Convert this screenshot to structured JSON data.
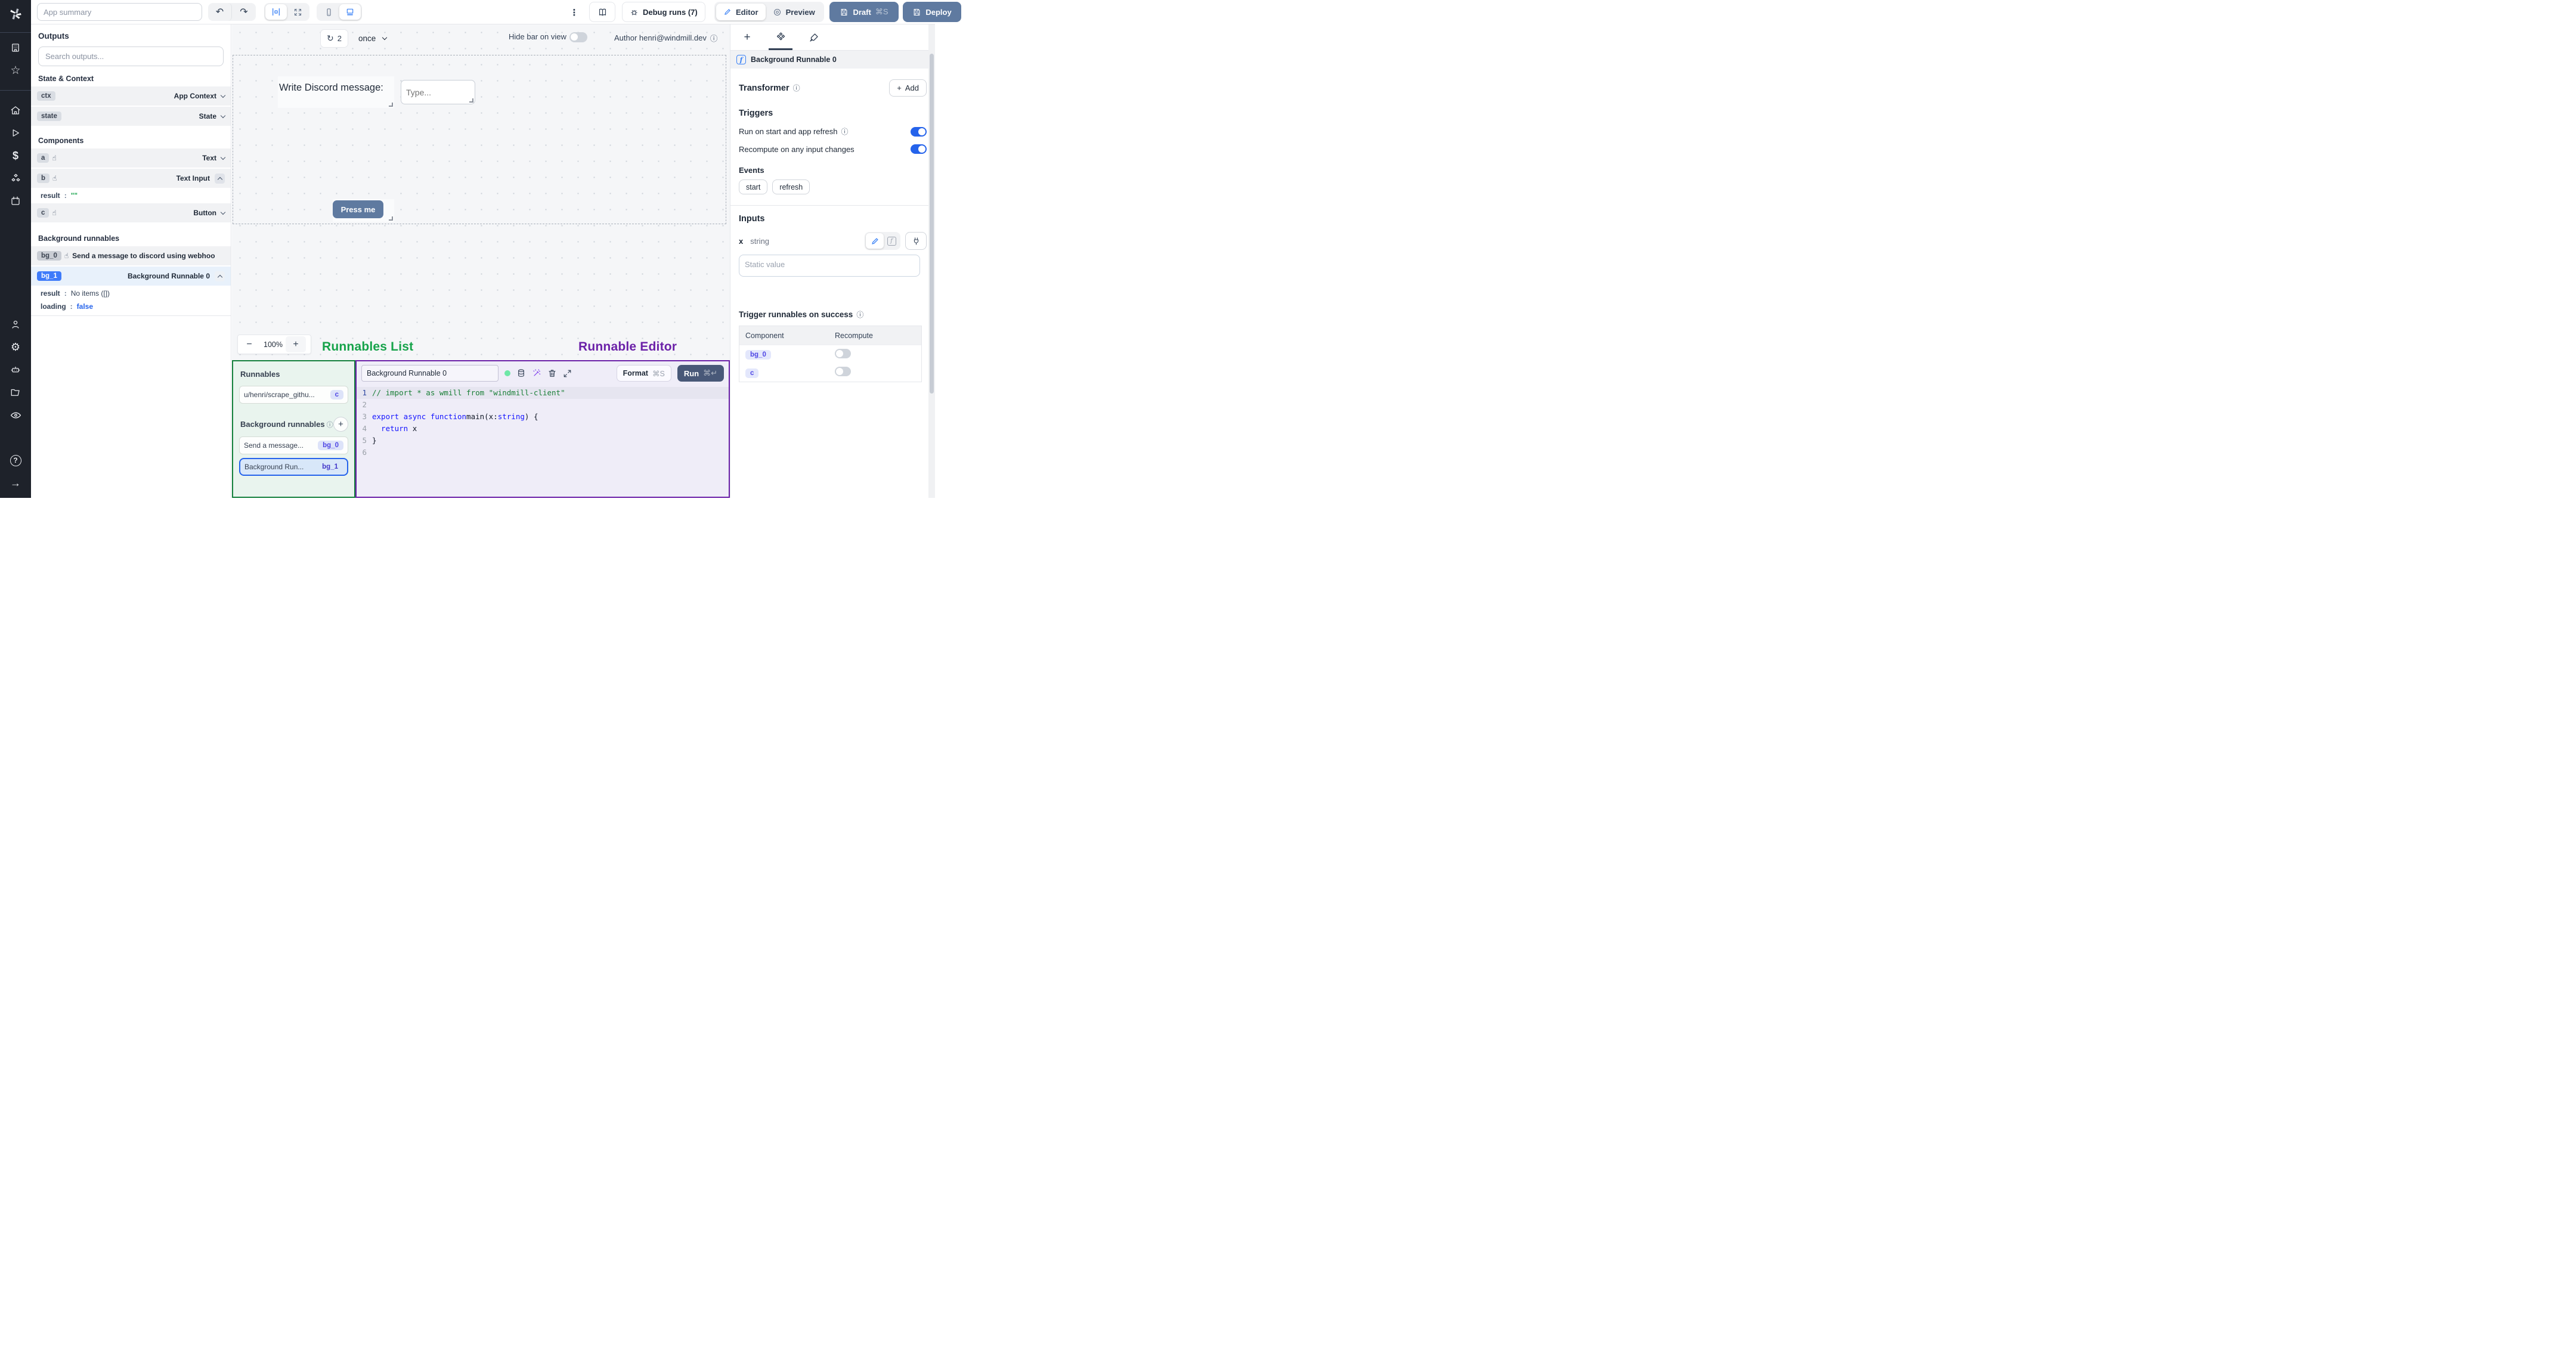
{
  "app": {
    "title_placeholder": "App summary"
  },
  "topbar": {
    "kebab": "⋮",
    "debug_runs": "Debug runs (7)",
    "editor": "Editor",
    "preview": "Preview",
    "draft": "Draft",
    "draft_kbd": "⌘S",
    "deploy": "Deploy",
    "undo": "↶",
    "redo": "↷"
  },
  "canvas": {
    "refresh_icon": "↻",
    "refresh_count": "2",
    "schedule": "once",
    "hide_bar_label": "Hide bar on view",
    "author": "Author henri@windmill.dev",
    "info": "ⓘ",
    "zoom_minus": "−",
    "zoom_level": "100%",
    "zoom_plus": "+",
    "text_component": "Write Discord message:",
    "input_placeholder": "Type...",
    "button_label": "Press me",
    "annotation_runnables": "Runnables List",
    "annotation_editor": "Runnable Editor"
  },
  "outputs": {
    "title": "Outputs",
    "search_placeholder": "Search outputs...",
    "section_state": "State & Context",
    "section_components": "Components",
    "section_background": "Background runnables",
    "pointer_glyph": "☝",
    "rows": {
      "ctx_id": "ctx",
      "ctx_type": "App Context",
      "state_id": "state",
      "state_type": "State",
      "a_id": "a",
      "a_type": "Text",
      "b_id": "b",
      "b_type": "Text Input",
      "b_result_key": "result",
      "b_result_colon": ":",
      "b_result_val": "\"\"",
      "c_id": "c",
      "c_type": "Button",
      "bg0_id": "bg_0",
      "bg0_name": "Send a message to discord using webhoo",
      "bg1_id": "bg_1",
      "bg1_name": "Background Runnable 0",
      "bg1_result_key": "result",
      "bg1_result_colon": ":",
      "bg1_result_val": "No items ([])",
      "bg1_loading_key": "loading",
      "bg1_loading_colon": ":",
      "bg1_loading_val": "false"
    }
  },
  "runnables_panel": {
    "title": "Runnables",
    "item_script_name": "u/henri/scrape_githu...",
    "item_script_badge": "c",
    "bg_title": "Background runnables",
    "bg_info": "ⓘ",
    "add_plus": "+",
    "item_bg0_name": "Send a message...",
    "item_bg0_badge": "bg_0",
    "item_bg1_name": "Background Run...",
    "item_bg1_badge": "bg_1"
  },
  "editor": {
    "name_value": "Background Runnable 0",
    "format_label": "Format",
    "format_kbd": "⌘S",
    "run_label": "Run",
    "run_kbd": "⌘↵",
    "lines": [
      {
        "n": "1",
        "s0": "// import * as wmill from \"windmill-client\""
      },
      {
        "n": "2"
      },
      {
        "n": "3",
        "s0": "export async function ",
        "s1": "main",
        "s2": "(x: ",
        "s3": "string",
        "s4": ") {"
      },
      {
        "n": "4",
        "s0": "  return",
        "s1": " x"
      },
      {
        "n": "5",
        "s0": "}"
      },
      {
        "n": "6"
      }
    ]
  },
  "panel": {
    "header": "Background Runnable 0",
    "f_glyph": "f",
    "transformer": "Transformer",
    "add_label": "Add",
    "add_plus": "+",
    "triggers": "Triggers",
    "run_on_start": "Run on start and app refresh",
    "recompute_any": "Recompute on any input changes",
    "events": "Events",
    "event_start": "start",
    "event_refresh": "refresh",
    "inputs": "Inputs",
    "input_name": "x",
    "input_type": "string",
    "static_placeholder": "Static value",
    "trigger_success": "Trigger runnables on success",
    "info": "ⓘ",
    "table": {
      "col_component": "Component",
      "col_recompute": "Recompute",
      "rows": [
        {
          "badge": "bg_0"
        },
        {
          "badge": "c"
        }
      ]
    }
  },
  "colors": {
    "accent_blue": "#3b82f6",
    "slate_button": "#5f7aa0",
    "run_button": "#485878",
    "annotation_green": "#16a34a",
    "annotation_purple": "#6b21a8",
    "indigo_badge": "#4f46e5",
    "sidebar_bg": "#1e222a"
  }
}
